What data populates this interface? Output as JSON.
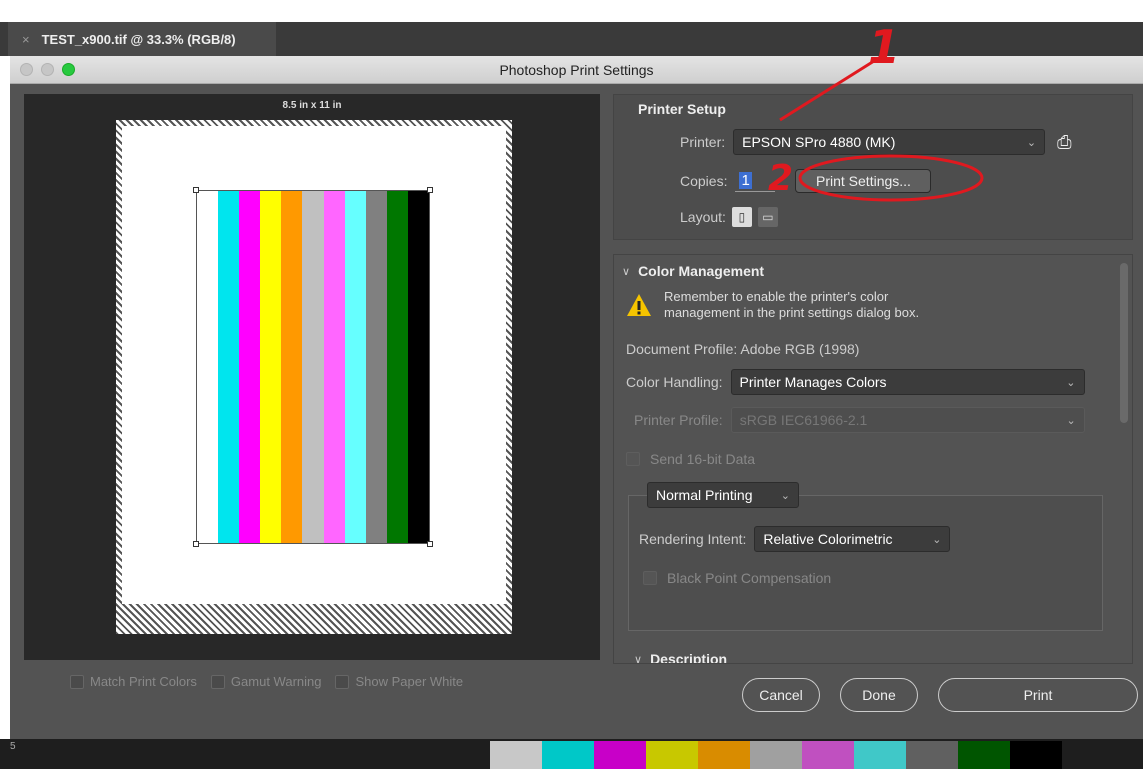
{
  "document_tab": {
    "close": "×",
    "title": "TEST_x900.tif @ 33.3% (RGB/8)"
  },
  "dialog": {
    "title": "Photoshop Print Settings"
  },
  "preview": {
    "paper_size": "8.5 in x 11 in",
    "color_bars": [
      "#ffffff",
      "#00e5ee",
      "#ff00ff",
      "#ffff00",
      "#ff9900",
      "#c0c0c0",
      "#ff66ff",
      "#66ffff",
      "#808080",
      "#007700",
      "#000000"
    ],
    "match_print_colors": "Match Print Colors",
    "gamut_warning": "Gamut Warning",
    "show_paper_white": "Show Paper White"
  },
  "printer_setup": {
    "title": "Printer Setup",
    "printer_label": "Printer:",
    "printer_value": "EPSON SPro 4880 (MK)",
    "copies_label": "Copies:",
    "copies_value": "1",
    "print_settings_button": "Print Settings...",
    "layout_label": "Layout:"
  },
  "color_management": {
    "title": "Color Management",
    "warning_line1": "Remember to enable the printer's color",
    "warning_line2": "management in the print settings dialog box.",
    "document_profile": "Document Profile: Adobe RGB (1998)",
    "color_handling_label": "Color Handling:",
    "color_handling_value": "Printer Manages Colors",
    "printer_profile_label": "Printer Profile:",
    "printer_profile_value": "sRGB IEC61966-2.1",
    "send_16bit": "Send 16-bit Data",
    "printing_mode": "Normal Printing",
    "rendering_intent_label": "Rendering Intent:",
    "rendering_intent_value": "Relative Colorimetric",
    "black_point": "Black Point Compensation"
  },
  "description": {
    "title": "Description"
  },
  "footer": {
    "cancel": "Cancel",
    "done": "Done",
    "print": "Print"
  },
  "annotations": {
    "one": "1",
    "two": "2"
  },
  "strip": {
    "left_label": "5",
    "swatches": [
      "#c8c8c8",
      "#00c8c8",
      "#c800c8",
      "#c8c800",
      "#d98c00",
      "#a0a0a0",
      "#c050c0",
      "#40c8c8",
      "#606060",
      "#005500",
      "#000000"
    ]
  },
  "colors": {
    "accent": "#3d6fd2",
    "annotation": "#e0191f",
    "warning": "#f5c400"
  }
}
